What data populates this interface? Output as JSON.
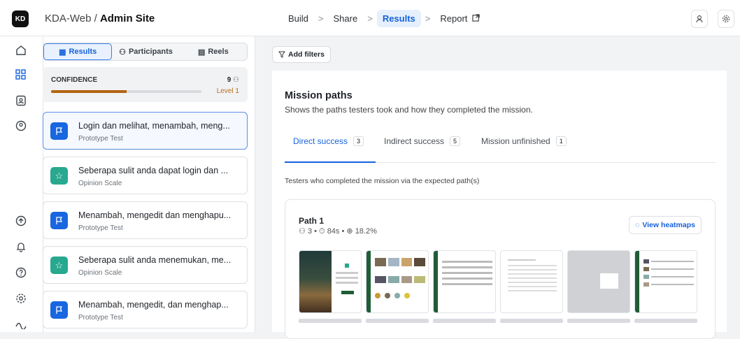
{
  "header": {
    "logo": "KD",
    "project": "KDA-Web",
    "separator": "/",
    "page": "Admin Site",
    "steps": [
      {
        "label": "Build"
      },
      {
        "label": "Share"
      },
      {
        "label": "Results"
      },
      {
        "label": "Report"
      }
    ],
    "step_separator": ">",
    "report_icon": "external-link-icon"
  },
  "sidebar": {
    "icons": [
      "home-icon",
      "grid-icon",
      "contacts-icon",
      "user-pin-icon",
      "upload-icon",
      "bell-icon",
      "help-icon",
      "settings-icon",
      "sparkles-icon"
    ]
  },
  "left_panel": {
    "tabs": [
      {
        "label": "Results",
        "icon": "chart-icon"
      },
      {
        "label": "Participants",
        "icon": "people-icon"
      },
      {
        "label": "Reels",
        "icon": "film-icon"
      }
    ],
    "confidence": {
      "label": "CONFIDENCE",
      "count": "9",
      "level": "Level 1",
      "progress_fraction": 0.5
    },
    "questions": [
      {
        "title": "Login dan melihat, menambah, meng...",
        "type": "Prototype Test",
        "icon": "flag-icon"
      },
      {
        "title": "Seberapa sulit anda dapat login dan ...",
        "type": "Opinion Scale",
        "icon": "star-icon"
      },
      {
        "title": "Menambah, mengedit dan menghapu...",
        "type": "Prototype Test",
        "icon": "flag-icon"
      },
      {
        "title": "Seberapa sulit anda menemukan, me...",
        "type": "Opinion Scale",
        "icon": "star-icon"
      },
      {
        "title": "Menambah, mengedit, dan menghap...",
        "type": "Prototype Test",
        "icon": "flag-icon"
      }
    ]
  },
  "filters": {
    "add_label": "Add filters"
  },
  "mission": {
    "title": "Mission paths",
    "subtitle": "Shows the paths testers took and how they completed the mission.",
    "tabs": [
      {
        "label": "Direct success",
        "count": "3"
      },
      {
        "label": "Indirect success",
        "count": "5"
      },
      {
        "label": "Mission unfinished",
        "count": "1"
      }
    ],
    "description": "Testers who completed the mission via the expected path(s)",
    "path": {
      "name": "Path 1",
      "testers": "3",
      "time": "84s",
      "rate": "18.2%",
      "heatmap_label": "View heatmaps"
    }
  },
  "colors": {
    "accent": "#1662dd",
    "progress": "#b36510",
    "teal": "#27a88f"
  }
}
